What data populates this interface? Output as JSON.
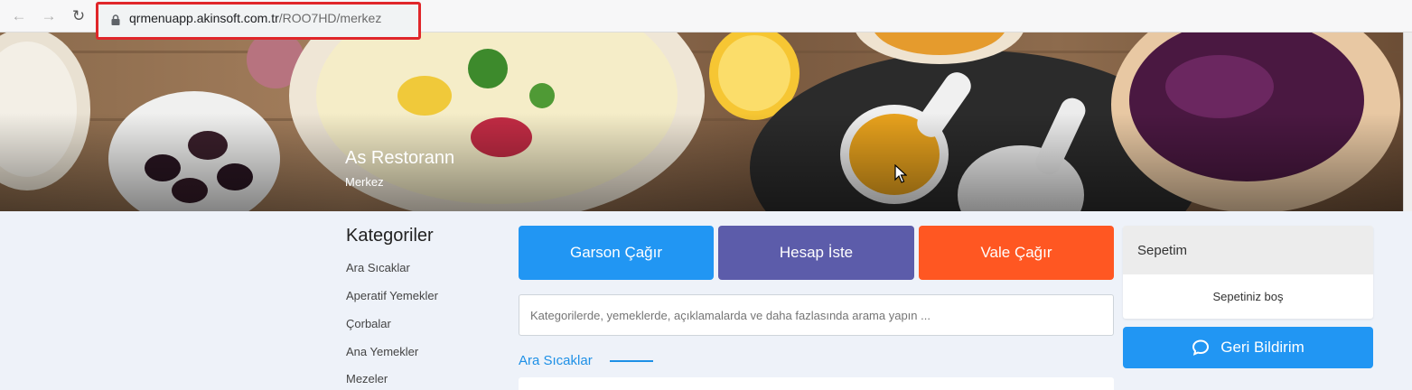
{
  "browser": {
    "back_icon": "arrow-left-icon",
    "forward_icon": "arrow-right-icon",
    "reload_icon": "reload-icon",
    "url_domain": "qrmenuapp.akinsoft.com.tr",
    "url_path": "/ROO7HD/merkez",
    "highlight_color": "#e0262a"
  },
  "hero": {
    "restaurant_name": "As Restorann",
    "branch": "Merkez"
  },
  "categories": {
    "title": "Kategoriler",
    "items": [
      "Ara Sıcaklar",
      "Aperatif Yemekler",
      "Çorbalar",
      "Ana Yemekler",
      "Mezeler"
    ]
  },
  "actions": {
    "garson": "Garson Çağır",
    "hesap": "Hesap İste",
    "vale": "Vale Çağır",
    "colors": {
      "garson": "#2196f3",
      "hesap": "#5c5caa",
      "vale": "#ff5722"
    }
  },
  "search": {
    "placeholder": "Kategorilerde, yemeklerde, açıklamalarda ve daha fazlasında arama yapın ..."
  },
  "section": {
    "title": "Ara Sıcaklar"
  },
  "cart": {
    "title": "Sepetim",
    "empty_text": "Sepetiniz boş"
  },
  "feedback": {
    "label": "Geri Bildirim",
    "icon": "chat-bubble-icon"
  }
}
